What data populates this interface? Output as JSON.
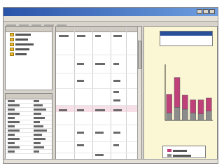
{
  "colors": {
    "titlebar": "#2a54a8",
    "series_top": "#c0407a",
    "series_bottom": "#8c8c8c",
    "chart_bg": "#fbf7d4"
  },
  "icons": [
    "folder-icon"
  ],
  "tree": {
    "items": [
      "",
      "",
      "",
      "",
      ""
    ]
  },
  "chart_data": {
    "type": "bar",
    "stacked": true,
    "categories": [
      "",
      "",
      "",
      "",
      "",
      ""
    ],
    "series": [
      {
        "values": [
          8,
          14,
          12,
          8,
          7,
          10
        ]
      },
      {
        "values": [
          20,
          32,
          15,
          14,
          15,
          14
        ]
      }
    ],
    "ylim": [
      0,
      60
    ],
    "grid": false
  }
}
